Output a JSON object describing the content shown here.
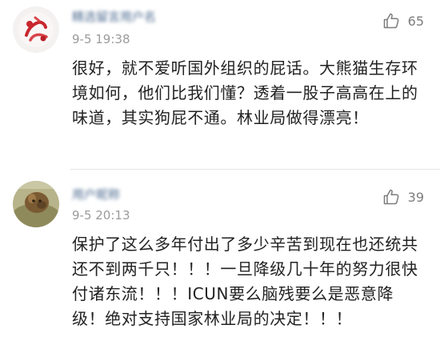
{
  "comments": [
    {
      "username": "精选留言用户名",
      "timestamp": "9-5 19:38",
      "likes": "65",
      "text": "很好，就不爱听国外组织的屁话。大熊猫生存环境如何，他们比我们懂？透着一股子高高在上的味道，其实狗屁不通。林业局做得漂亮！",
      "avatar_icon": "red-white-abstract-avatar"
    },
    {
      "username": "用户昵称",
      "timestamp": "9-5 20:13",
      "likes": "39",
      "text": "保护了这么多年付出了多少辛苦到现在也还统共还不到两千只！！！一旦降级几十年的努力很快付诸东流！！！ICUN要么脑残要么是恶意降级！绝对支持国家林业局的决定！！！",
      "avatar_icon": "brown-animal-photo-avatar"
    }
  ],
  "like_icon": "thumbs-up-icon",
  "colors": {
    "username": "#4c6a8f",
    "timestamp": "#9b9b9b",
    "body": "#222222",
    "like": "#7d7d7d"
  }
}
